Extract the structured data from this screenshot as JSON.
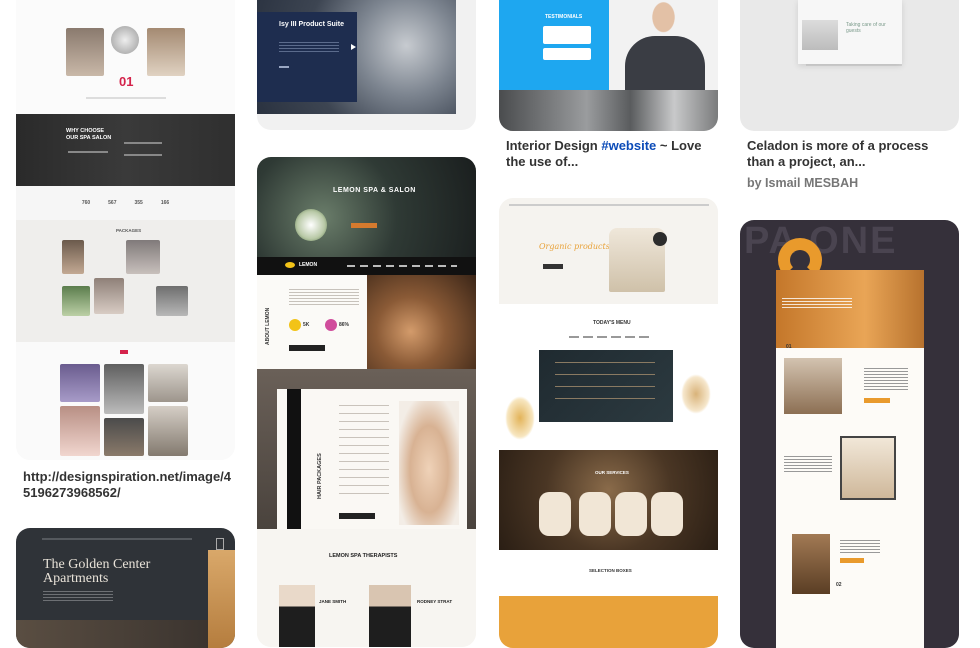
{
  "col1": {
    "pin1": {
      "salon_title": "WHY CHOOSE OUR SPA SALON",
      "big_number": "01",
      "stats": [
        "760",
        "567",
        "355",
        "166"
      ],
      "section_label": "PACKAGES"
    },
    "caption": "http://designspiration.net/image/45196273968562/",
    "pin2": {
      "headline": "The Golden Center Apartments"
    }
  },
  "col2": {
    "pin1": {
      "headline": "Isy III Product Suite"
    },
    "pin2": {
      "hero_title": "LEMON SPA & SALON",
      "brand": "LEMON",
      "about_label": "ABOUT LEMON",
      "stat1": "5K",
      "stat2": "86%",
      "packages_label": "HAIR PACKAGES",
      "therapists_label": "LEMON SPA THERAPISTS",
      "therapist1": "JANE SMITH",
      "therapist2": "RODNEY STRAT"
    }
  },
  "col3": {
    "pin1": {
      "badge": "TESTIMONIALS"
    },
    "caption_prefix": "Interior Design ",
    "caption_hashtag": "#website",
    "caption_suffix": " ~ Love the use of...",
    "pin2": {
      "hero_title": "Organic products!",
      "menu_title": "TODAY'S MENU",
      "services_title": "OUR SERVICES",
      "boxes_title": "SELECTION BOXES"
    }
  },
  "col4": {
    "pin1": {
      "tagline": "Taking care of our guests"
    },
    "caption": "Celadon is more of a process than a project, an...",
    "byline": "by Ismail MESBAH",
    "pin2": {
      "hero_letters": "PA ONE",
      "step1": "01",
      "step2": "02"
    }
  },
  "colors": {
    "accent_red": "#d4234b",
    "dark_navy": "#1e2d4f",
    "spa_dark": "#2b2b2b",
    "lemon_yellow": "#f2c318",
    "organic_orange": "#e8a23a",
    "interior_orange": "#e99a2c",
    "interior_dark": "#35303a",
    "link_blue": "#0b4bb8"
  }
}
